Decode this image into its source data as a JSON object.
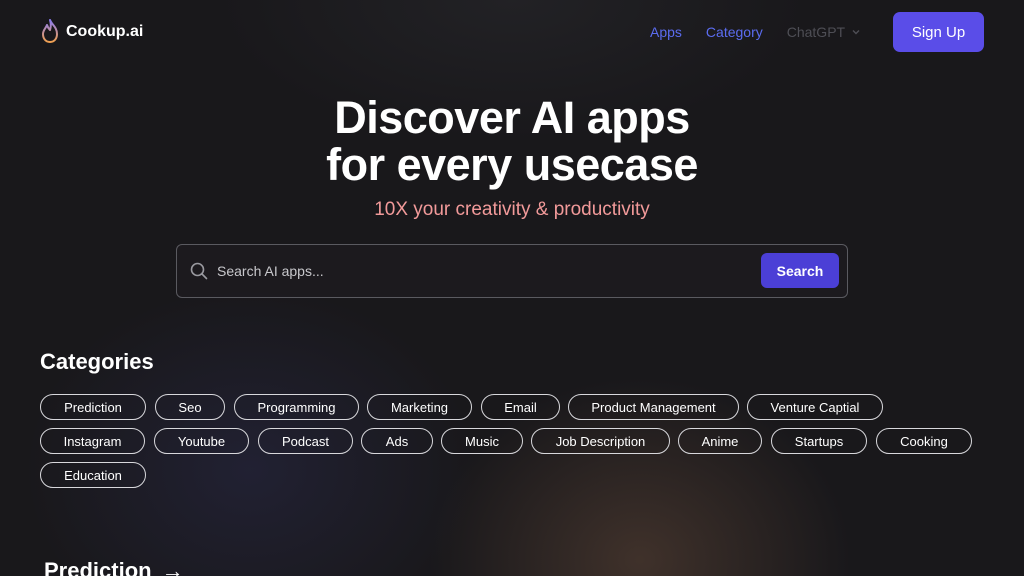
{
  "brand": {
    "name": "Cookup.ai",
    "icon": "flame-icon"
  },
  "nav": {
    "items": [
      {
        "label": "Apps"
      },
      {
        "label": "Category"
      },
      {
        "label": "ChatGPT"
      }
    ],
    "signup_label": "Sign Up"
  },
  "hero": {
    "title_line1": "Discover AI apps",
    "title_line2": "for every usecase",
    "subtitle": "10X your creativity & productivity"
  },
  "search": {
    "placeholder": "Search AI apps...",
    "button_label": "Search"
  },
  "categories": {
    "title": "Categories",
    "items": [
      "Prediction",
      "Seo",
      "Programming",
      "Marketing",
      "Email",
      "Product Management",
      "Venture Captial",
      "Instagram",
      "Youtube",
      "Podcast",
      "Ads",
      "Music",
      "Job Description",
      "Anime",
      "Startups",
      "Cooking",
      "Education"
    ]
  },
  "section": {
    "title": "Prediction",
    "arrow": "→"
  },
  "colors": {
    "background": "#19181b",
    "accent": "#5a4de8",
    "nav_link": "#5b6cf0",
    "subtitle": "#f29a9a"
  }
}
